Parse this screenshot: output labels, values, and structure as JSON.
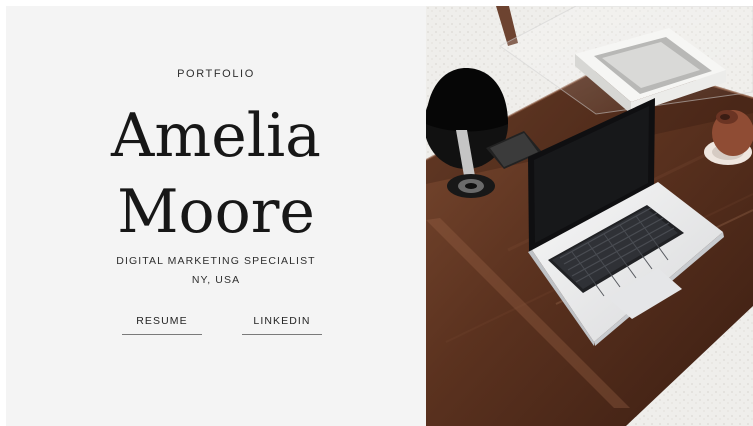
{
  "hero": {
    "eyebrow": "PORTFOLIO",
    "first_name": "Amelia",
    "last_name": "Moore",
    "role": "DIGITAL MARKETING SPECIALIST",
    "location": "NY, USA"
  },
  "links": {
    "resume": "RESUME",
    "linkedin": "LINKEDIN"
  },
  "photo": {
    "subject": "laptop on a wooden desk with a black lamp and a small ceramic vase on a white rug",
    "icons": [
      "laptop",
      "desk-lamp",
      "vase"
    ]
  },
  "colors": {
    "panel_background": "#f4f4f4",
    "text_primary": "#171717",
    "underline": "#7a7a7a",
    "wood": "#5a3020",
    "rug": "#efeeeb"
  }
}
